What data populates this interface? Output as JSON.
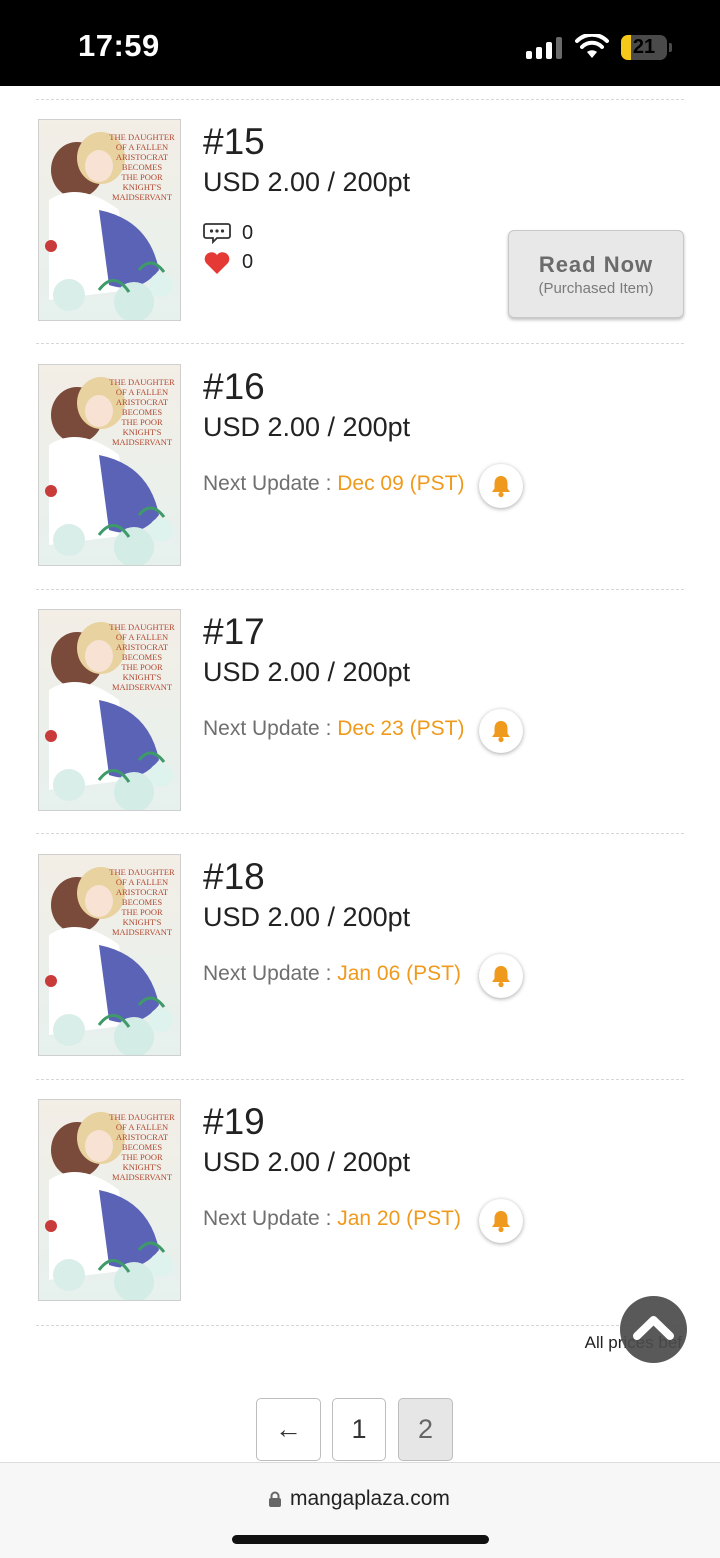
{
  "status_bar": {
    "time": "17:59",
    "battery": "21",
    "battery_level": 0.21
  },
  "episodes": [
    {
      "number": "#15",
      "price": "USD 2.00 / 200pt",
      "comments": "0",
      "likes": "0",
      "action": {
        "label": "Read Now",
        "sublabel": "(Purchased Item)"
      }
    },
    {
      "number": "#16",
      "price": "USD 2.00 / 200pt",
      "next_update_label": "Next Update : ",
      "next_update_date": "Dec 09 (PST)"
    },
    {
      "number": "#17",
      "price": "USD 2.00 / 200pt",
      "next_update_label": "Next Update : ",
      "next_update_date": "Dec 23 (PST)"
    },
    {
      "number": "#18",
      "price": "USD 2.00 / 200pt",
      "next_update_label": "Next Update : ",
      "next_update_date": "Jan 06 (PST)"
    },
    {
      "number": "#19",
      "price": "USD 2.00 / 200pt",
      "next_update_label": "Next Update : ",
      "next_update_date": "Jan 20 (PST)"
    }
  ],
  "cover": {
    "title_lines": [
      "The Daughter",
      "of a Fallen",
      "Aristocrat",
      "Becomes",
      "the Poor",
      "Knight's",
      "Maidservant"
    ]
  },
  "prices_note": "All prices bef",
  "pagination": {
    "prev": "←",
    "pages": [
      "1",
      "2"
    ],
    "current": "2"
  },
  "browser": {
    "url": "mangaplaza.com"
  },
  "colors": {
    "accent": "#ef9a1c",
    "like": "#e53935",
    "status_bg": "#000000"
  },
  "icons": {
    "comment": "comment-icon",
    "like": "heart-icon",
    "notify": "bell-icon",
    "scroll_top": "chevron-up-icon",
    "lock": "lock-icon"
  }
}
